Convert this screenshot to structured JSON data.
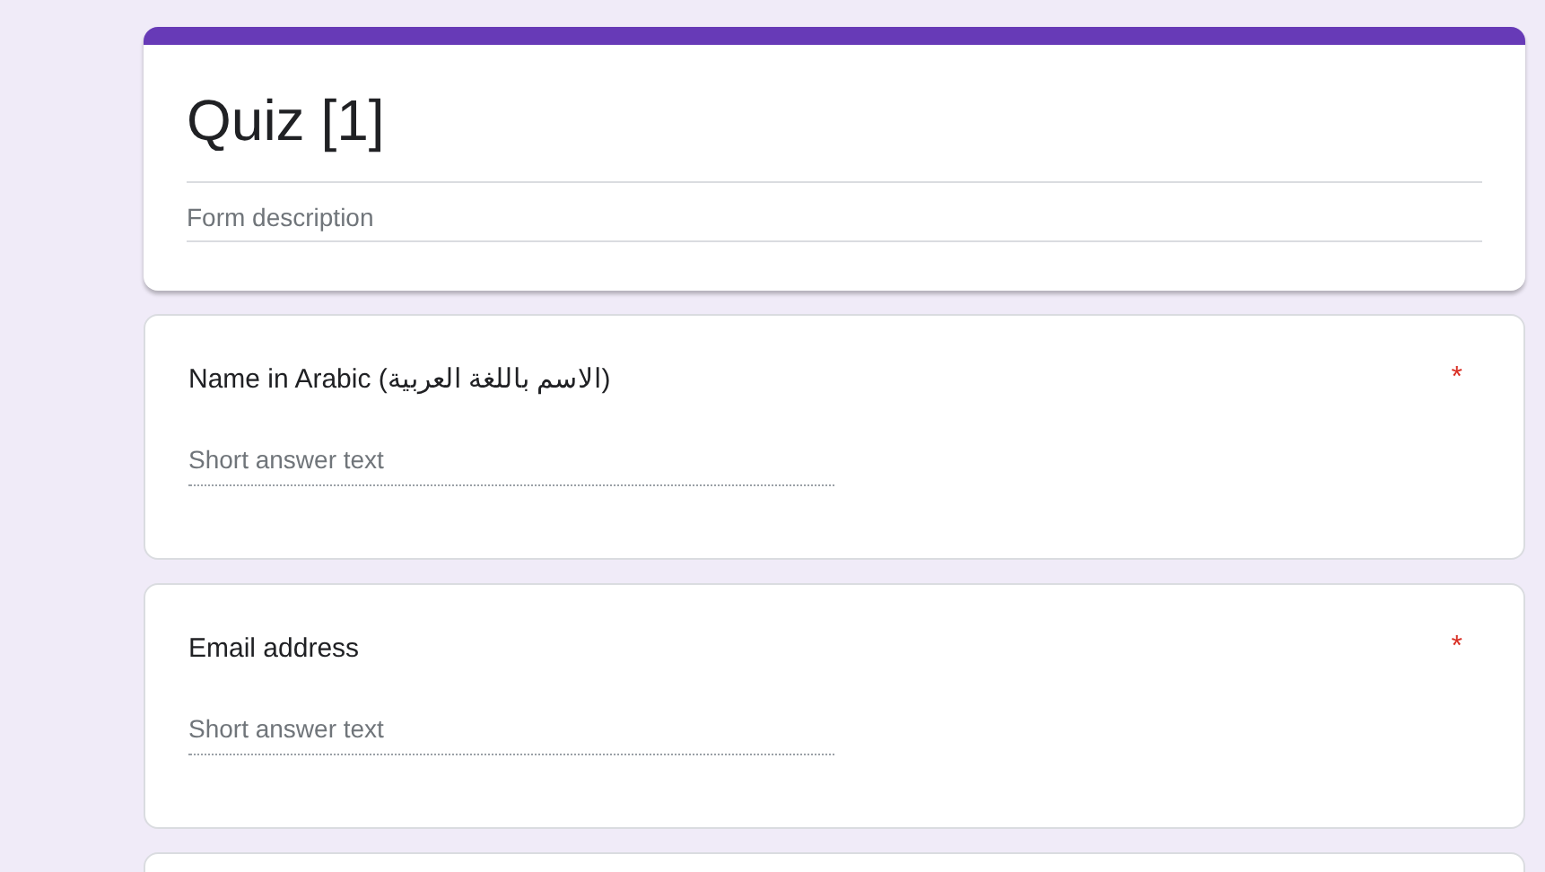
{
  "form": {
    "title": "Quiz [1]",
    "description_placeholder": "Form description"
  },
  "questions": [
    {
      "label": "Name in Arabic (الاسم باللغة العربية)",
      "placeholder": "Short answer text",
      "required_mark": "*"
    },
    {
      "label": "Email address",
      "placeholder": "Short answer text",
      "required_mark": "*"
    }
  ]
}
